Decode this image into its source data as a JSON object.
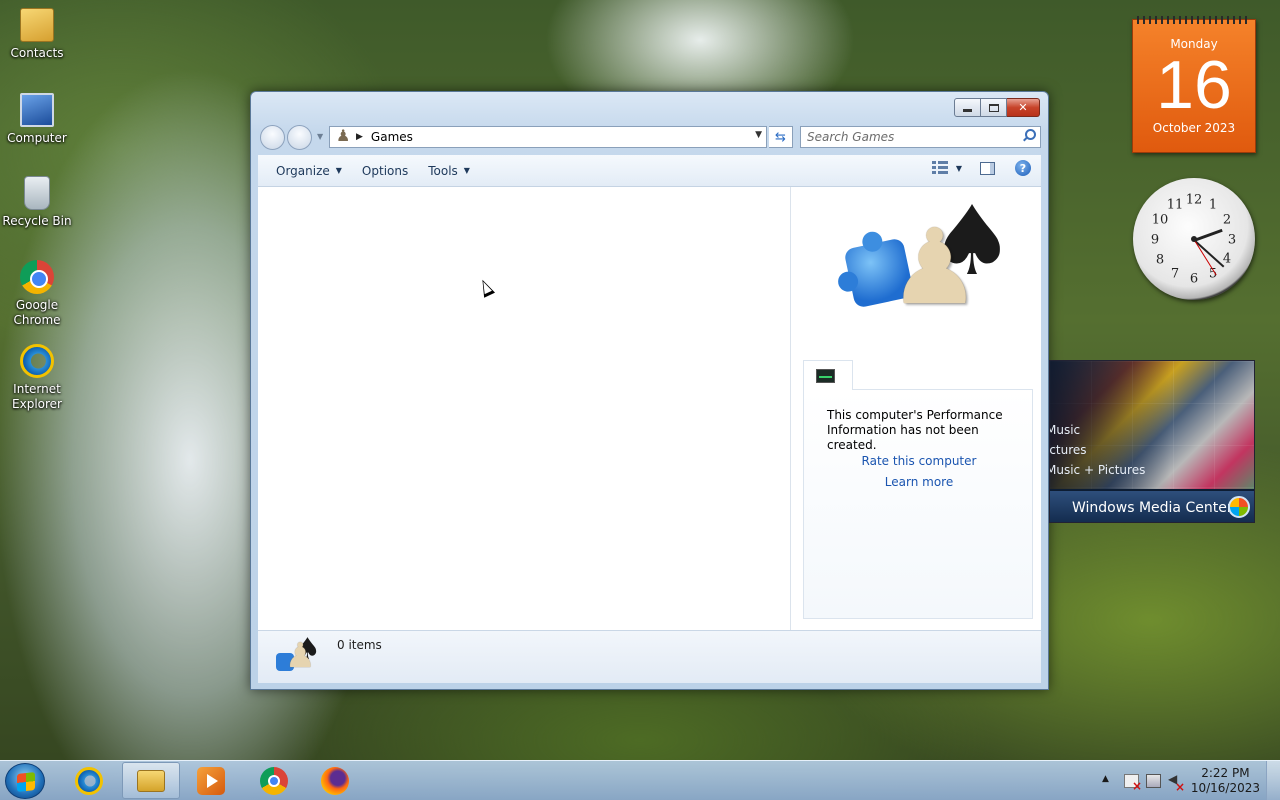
{
  "desktop": {
    "icons": [
      {
        "label": "Contacts",
        "icon": "contacts-icon"
      },
      {
        "label": "Computer",
        "icon": "computer-icon"
      },
      {
        "label": "Recycle Bin",
        "icon": "recycle-bin-icon"
      },
      {
        "label": "Google Chrome",
        "icon": "chrome-icon"
      },
      {
        "label": "Internet Explorer",
        "icon": "internet-explorer-icon"
      }
    ]
  },
  "window": {
    "address": {
      "crumb": "Games"
    },
    "search": {
      "placeholder": "Search Games"
    },
    "toolbar": {
      "organize": "Organize",
      "options": "Options",
      "tools": "Tools",
      "help": "?"
    },
    "details": {
      "performance_text": "This computer's Performance Information has not been created.",
      "rate_link": "Rate this computer",
      "learn_link": "Learn more"
    },
    "status": {
      "items_text": "0 items"
    }
  },
  "gadgets": {
    "calendar": {
      "weekday": "Monday",
      "day": "16",
      "month_year": "October 2023"
    },
    "clock": {
      "numerals": [
        "12",
        "1",
        "2",
        "3",
        "4",
        "5",
        "6",
        "7",
        "8",
        "9",
        "10",
        "11"
      ]
    },
    "media_center": {
      "items": [
        "Music",
        "ictures",
        "Music + Pictures"
      ],
      "title": "Windows Media Center"
    }
  },
  "taskbar": {
    "apps": [
      "internet-explorer",
      "windows-explorer",
      "windows-media-player",
      "google-chrome",
      "firefox"
    ],
    "time": "2:22 PM",
    "date": "10/16/2023"
  }
}
